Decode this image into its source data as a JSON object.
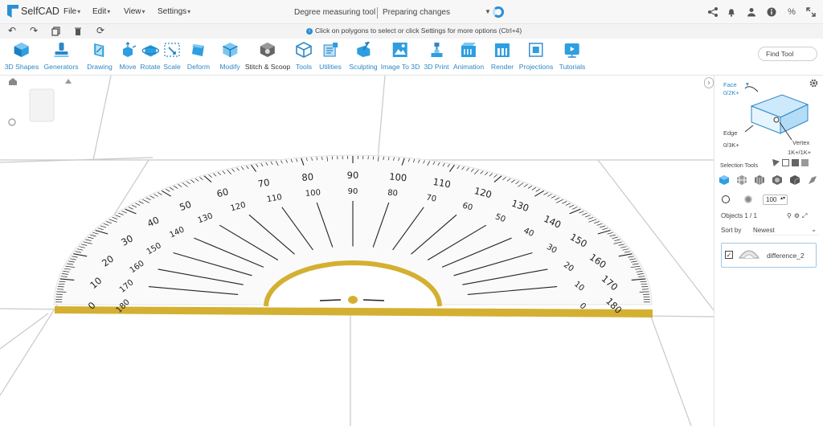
{
  "app": {
    "name": "SelfCAD"
  },
  "menus": [
    "File",
    "Edit",
    "View",
    "Settings"
  ],
  "header": {
    "doc_title": "Degree measuring tool",
    "status": "Preparing changes"
  },
  "hint": "Click on polygons to select or click Settings for more options (Ctrl+4)",
  "toolbar": {
    "tools": [
      "3D Shapes",
      "Generators",
      "Drawing",
      "Move",
      "Rotate",
      "Scale",
      "Deform",
      "Modify",
      "Stitch & Scoop",
      "Tools",
      "Utilities",
      "Sculpting",
      "Image To 3D",
      "3D Print",
      "Animation",
      "Render",
      "Projections",
      "Tutorials"
    ],
    "find_tool": "Find Tool"
  },
  "panel": {
    "face_label": "Face",
    "face_count": "0/2K+",
    "edge_label": "Edge",
    "edge_count": "0/3K+",
    "vertex_label": "Vertex",
    "vertex_count": "1K+/1K+",
    "selection_tools": "Selection Tools",
    "size_value": "100",
    "objects_label": "Objects 1 / 1",
    "sort_label": "Sort by",
    "sort_value": "Newest",
    "object_name": "difference_2"
  },
  "protractor": {
    "outer_numbers": [
      "0",
      "10",
      "20",
      "30",
      "40",
      "50",
      "60",
      "70",
      "80",
      "90",
      "100",
      "110",
      "120",
      "130",
      "140",
      "150",
      "160",
      "170",
      "180"
    ],
    "inner_numbers": [
      "180",
      "170",
      "160",
      "150",
      "140",
      "130",
      "120",
      "110",
      "100",
      "90",
      "80",
      "70",
      "60",
      "50",
      "40",
      "30",
      "20",
      "10",
      "0"
    ]
  },
  "colors": {
    "accent": "#2d87c8",
    "protractor_edge": "#d4b032",
    "grid_line": "#bfbfbf"
  }
}
